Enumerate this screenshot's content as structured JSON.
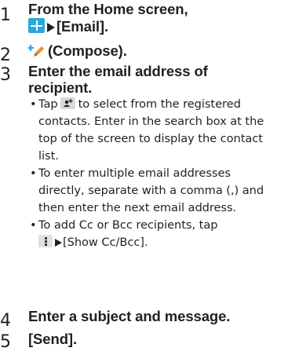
{
  "steps": [
    {
      "number": "1",
      "line1": "From the Home screen,",
      "line2": "[Email].",
      "icon": "apps-icon"
    },
    {
      "number": "2",
      "text": "(Compose).",
      "icon": "compose-icon"
    },
    {
      "number": "3",
      "line1": "Enter the email address of",
      "line2": "recipient."
    },
    {
      "number": "4",
      "text": "Enter a subject and message."
    },
    {
      "number": "5",
      "text": "[Send]."
    }
  ],
  "bullets": {
    "marker": "•",
    "b1_pre": "Tap",
    "b1_icon": "add-contact-icon",
    "b1_line1": "to select from the registered",
    "b1_line2": "contacts. Enter in the search box at the",
    "b1_line3": "top of the screen to display the contact",
    "b1_line4": "list.",
    "b2_line1": "To enter multiple email addresses",
    "b2_line2": "directly, separate with a comma (,) and",
    "b2_line3": "then enter the next email address.",
    "b3_line1": "To add Cc or Bcc recipients, tap",
    "b3_icon": "overflow-menu-icon",
    "b3_line2": "[Show Cc/Bcc]."
  },
  "colors": {
    "text": "#231f20",
    "apps_icon": "#29a7df",
    "compose_icon_plus": "#29a7df",
    "compose_icon_pencil": "#e8912d",
    "grey_icon": "#d9d9d9"
  }
}
